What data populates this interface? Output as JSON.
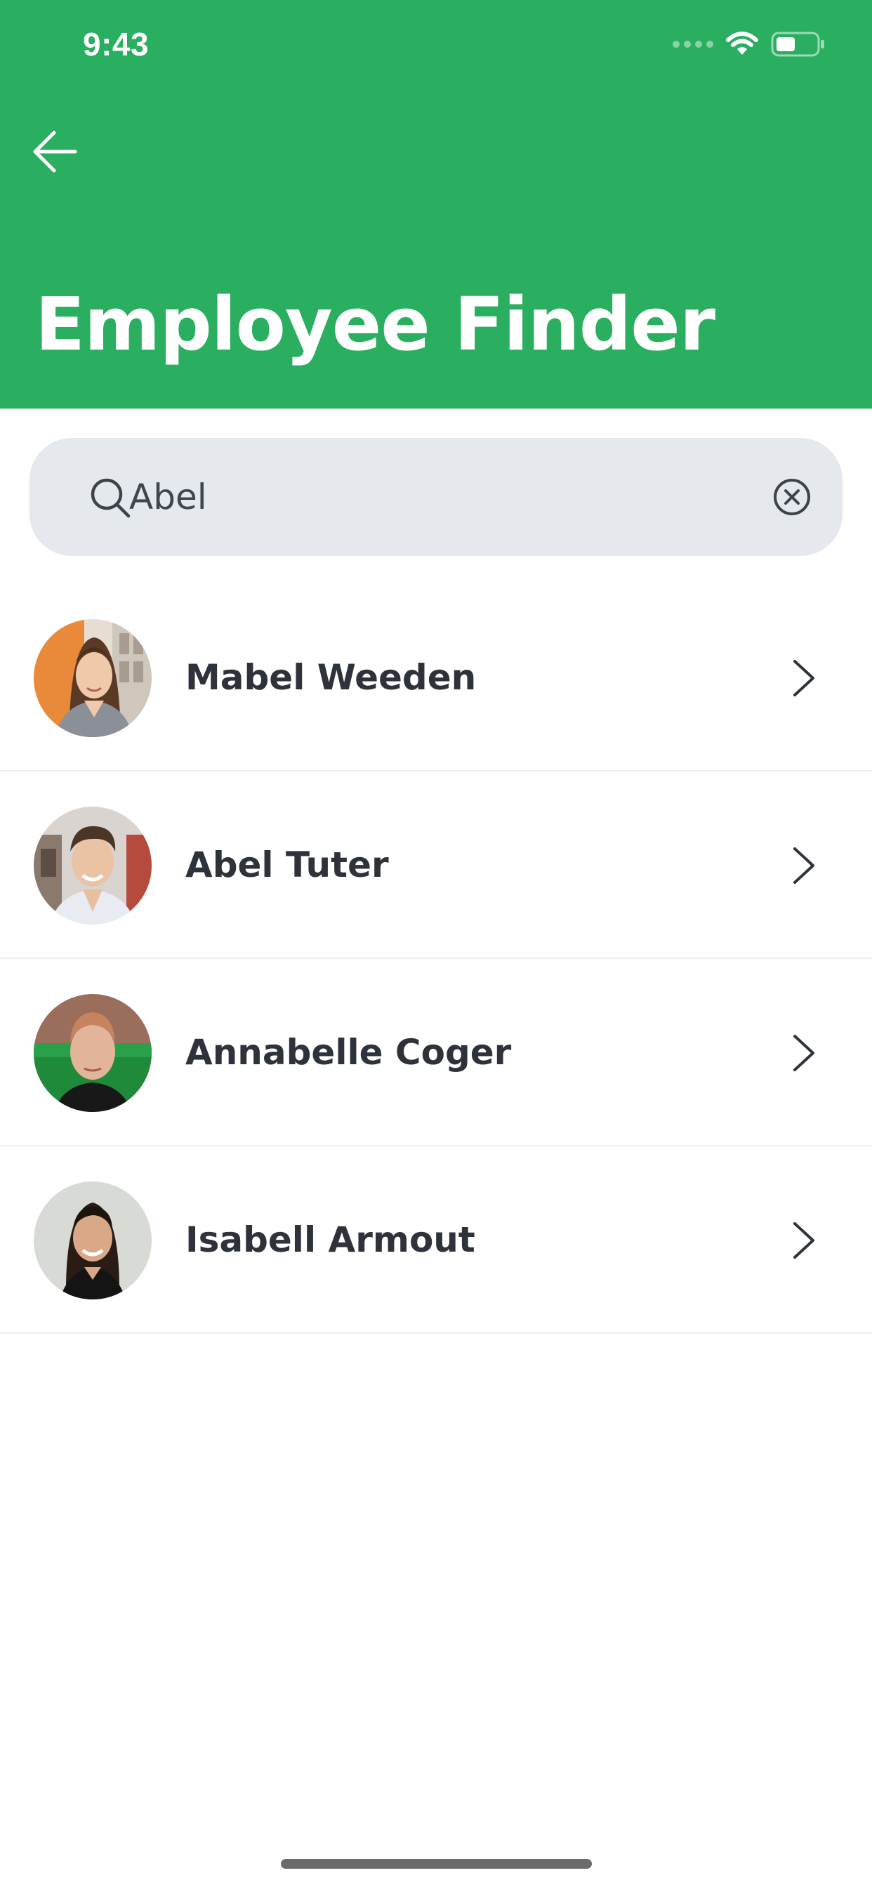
{
  "status_bar": {
    "time": "9:43",
    "icons": [
      "signal-dots-icon",
      "wifi-icon",
      "battery-icon"
    ]
  },
  "header": {
    "back_icon": "arrow-left-icon",
    "title": "Employee Finder",
    "background_color": "#2aae5f"
  },
  "search": {
    "icon": "search-icon",
    "value": "Abel",
    "clear_icon": "clear-circle-x-icon",
    "background_color": "#e5e8ec"
  },
  "employees": [
    {
      "name": "Mabel Weeden",
      "chevron_icon": "chevron-right-icon"
    },
    {
      "name": "Abel Tuter",
      "chevron_icon": "chevron-right-icon"
    },
    {
      "name": "Annabelle Coger",
      "chevron_icon": "chevron-right-icon"
    },
    {
      "name": "Isabell Armout",
      "chevron_icon": "chevron-right-icon"
    }
  ]
}
